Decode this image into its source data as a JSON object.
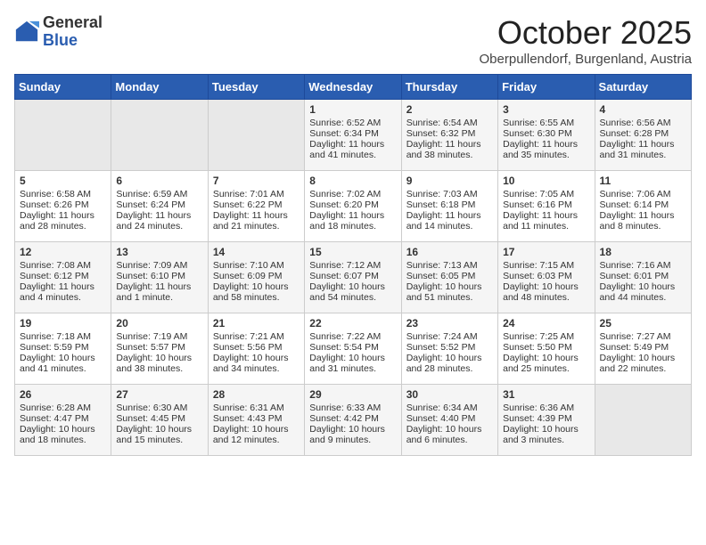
{
  "logo": {
    "general": "General",
    "blue": "Blue"
  },
  "title": "October 2025",
  "subtitle": "Oberpullendorf, Burgenland, Austria",
  "days_of_week": [
    "Sunday",
    "Monday",
    "Tuesday",
    "Wednesday",
    "Thursday",
    "Friday",
    "Saturday"
  ],
  "weeks": [
    [
      {
        "day": "",
        "info": ""
      },
      {
        "day": "",
        "info": ""
      },
      {
        "day": "",
        "info": ""
      },
      {
        "day": "1",
        "info": "Sunrise: 6:52 AM\nSunset: 6:34 PM\nDaylight: 11 hours and 41 minutes."
      },
      {
        "day": "2",
        "info": "Sunrise: 6:54 AM\nSunset: 6:32 PM\nDaylight: 11 hours and 38 minutes."
      },
      {
        "day": "3",
        "info": "Sunrise: 6:55 AM\nSunset: 6:30 PM\nDaylight: 11 hours and 35 minutes."
      },
      {
        "day": "4",
        "info": "Sunrise: 6:56 AM\nSunset: 6:28 PM\nDaylight: 11 hours and 31 minutes."
      }
    ],
    [
      {
        "day": "5",
        "info": "Sunrise: 6:58 AM\nSunset: 6:26 PM\nDaylight: 11 hours and 28 minutes."
      },
      {
        "day": "6",
        "info": "Sunrise: 6:59 AM\nSunset: 6:24 PM\nDaylight: 11 hours and 24 minutes."
      },
      {
        "day": "7",
        "info": "Sunrise: 7:01 AM\nSunset: 6:22 PM\nDaylight: 11 hours and 21 minutes."
      },
      {
        "day": "8",
        "info": "Sunrise: 7:02 AM\nSunset: 6:20 PM\nDaylight: 11 hours and 18 minutes."
      },
      {
        "day": "9",
        "info": "Sunrise: 7:03 AM\nSunset: 6:18 PM\nDaylight: 11 hours and 14 minutes."
      },
      {
        "day": "10",
        "info": "Sunrise: 7:05 AM\nSunset: 6:16 PM\nDaylight: 11 hours and 11 minutes."
      },
      {
        "day": "11",
        "info": "Sunrise: 7:06 AM\nSunset: 6:14 PM\nDaylight: 11 hours and 8 minutes."
      }
    ],
    [
      {
        "day": "12",
        "info": "Sunrise: 7:08 AM\nSunset: 6:12 PM\nDaylight: 11 hours and 4 minutes."
      },
      {
        "day": "13",
        "info": "Sunrise: 7:09 AM\nSunset: 6:10 PM\nDaylight: 11 hours and 1 minute."
      },
      {
        "day": "14",
        "info": "Sunrise: 7:10 AM\nSunset: 6:09 PM\nDaylight: 10 hours and 58 minutes."
      },
      {
        "day": "15",
        "info": "Sunrise: 7:12 AM\nSunset: 6:07 PM\nDaylight: 10 hours and 54 minutes."
      },
      {
        "day": "16",
        "info": "Sunrise: 7:13 AM\nSunset: 6:05 PM\nDaylight: 10 hours and 51 minutes."
      },
      {
        "day": "17",
        "info": "Sunrise: 7:15 AM\nSunset: 6:03 PM\nDaylight: 10 hours and 48 minutes."
      },
      {
        "day": "18",
        "info": "Sunrise: 7:16 AM\nSunset: 6:01 PM\nDaylight: 10 hours and 44 minutes."
      }
    ],
    [
      {
        "day": "19",
        "info": "Sunrise: 7:18 AM\nSunset: 5:59 PM\nDaylight: 10 hours and 41 minutes."
      },
      {
        "day": "20",
        "info": "Sunrise: 7:19 AM\nSunset: 5:57 PM\nDaylight: 10 hours and 38 minutes."
      },
      {
        "day": "21",
        "info": "Sunrise: 7:21 AM\nSunset: 5:56 PM\nDaylight: 10 hours and 34 minutes."
      },
      {
        "day": "22",
        "info": "Sunrise: 7:22 AM\nSunset: 5:54 PM\nDaylight: 10 hours and 31 minutes."
      },
      {
        "day": "23",
        "info": "Sunrise: 7:24 AM\nSunset: 5:52 PM\nDaylight: 10 hours and 28 minutes."
      },
      {
        "day": "24",
        "info": "Sunrise: 7:25 AM\nSunset: 5:50 PM\nDaylight: 10 hours and 25 minutes."
      },
      {
        "day": "25",
        "info": "Sunrise: 7:27 AM\nSunset: 5:49 PM\nDaylight: 10 hours and 22 minutes."
      }
    ],
    [
      {
        "day": "26",
        "info": "Sunrise: 6:28 AM\nSunset: 4:47 PM\nDaylight: 10 hours and 18 minutes."
      },
      {
        "day": "27",
        "info": "Sunrise: 6:30 AM\nSunset: 4:45 PM\nDaylight: 10 hours and 15 minutes."
      },
      {
        "day": "28",
        "info": "Sunrise: 6:31 AM\nSunset: 4:43 PM\nDaylight: 10 hours and 12 minutes."
      },
      {
        "day": "29",
        "info": "Sunrise: 6:33 AM\nSunset: 4:42 PM\nDaylight: 10 hours and 9 minutes."
      },
      {
        "day": "30",
        "info": "Sunrise: 6:34 AM\nSunset: 4:40 PM\nDaylight: 10 hours and 6 minutes."
      },
      {
        "day": "31",
        "info": "Sunrise: 6:36 AM\nSunset: 4:39 PM\nDaylight: 10 hours and 3 minutes."
      },
      {
        "day": "",
        "info": ""
      }
    ]
  ]
}
